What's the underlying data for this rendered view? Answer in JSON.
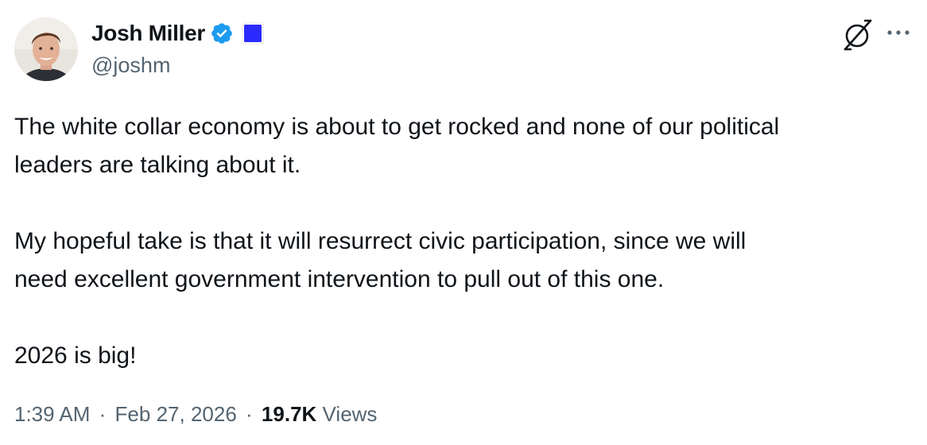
{
  "author": {
    "display_name": "Josh Miller",
    "handle": "@joshm",
    "verified_color": "#1d9bf0",
    "affiliate_color": "#2b2bff"
  },
  "header": {
    "logo_icon": "slashed-circle-logo-icon",
    "more_icon": "more-horizontal-icon"
  },
  "tweet": {
    "paragraphs": [
      "The white collar economy is about to get rocked and none of our political\nleaders are talking about it.",
      "My hopeful take is that it will resurrect civic participation, since we will\nneed excellent government intervention to pull out of this one.",
      "2026 is big!"
    ]
  },
  "meta": {
    "time": "1:39 AM",
    "date": "Feb 27, 2026",
    "separator": "·",
    "views_count": "19.7K",
    "views_label": "Views"
  }
}
